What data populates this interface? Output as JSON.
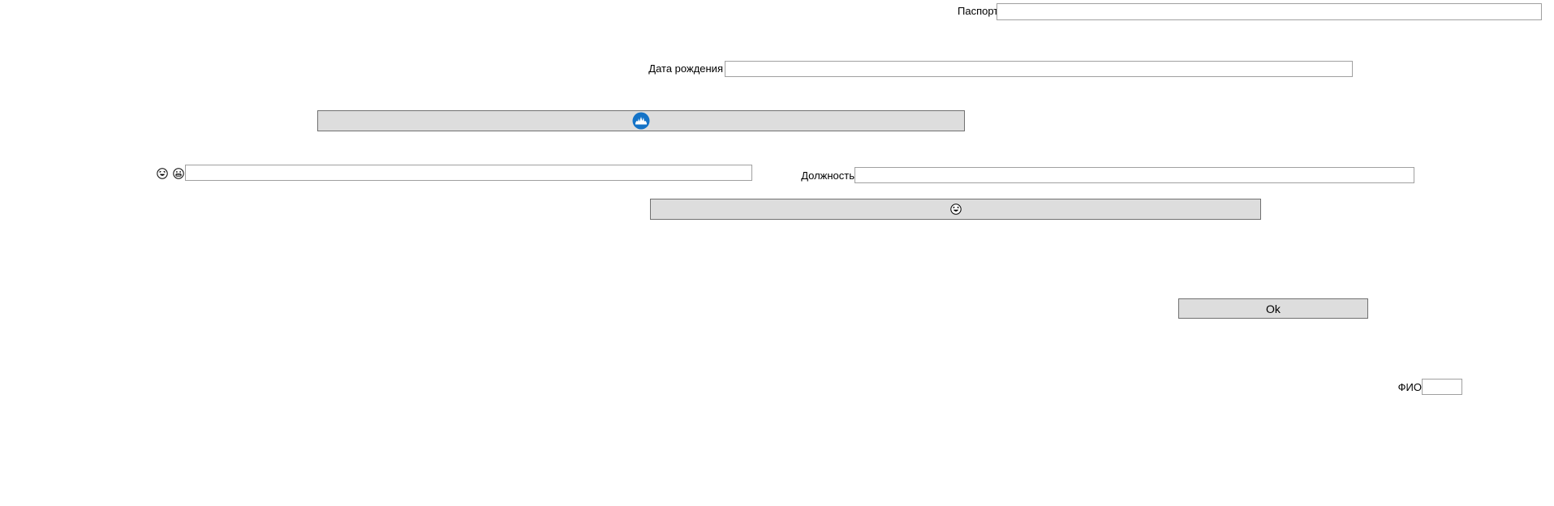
{
  "form": {
    "passport": {
      "label": "Паспорт",
      "value": ""
    },
    "birth_date": {
      "label": "Дата рождения",
      "value": ""
    },
    "position": {
      "label": "Должность",
      "value": ""
    },
    "emoji_field": {
      "value": ""
    },
    "fio": {
      "label": "ФИО",
      "value": ""
    },
    "ok_button": {
      "label": "Ok"
    }
  },
  "icons": {
    "logo_button_icon": "steam-app-logo-icon",
    "emoji_button_icon": "laughing-face-icon",
    "emoji_label_icons": [
      "laughing-face-icon",
      "grinning-face-icon"
    ]
  },
  "colors": {
    "button_bg": "#dddddd",
    "button_border": "#707070",
    "field_border": "#a0a0a0",
    "logo_blue": "#1473c7"
  }
}
